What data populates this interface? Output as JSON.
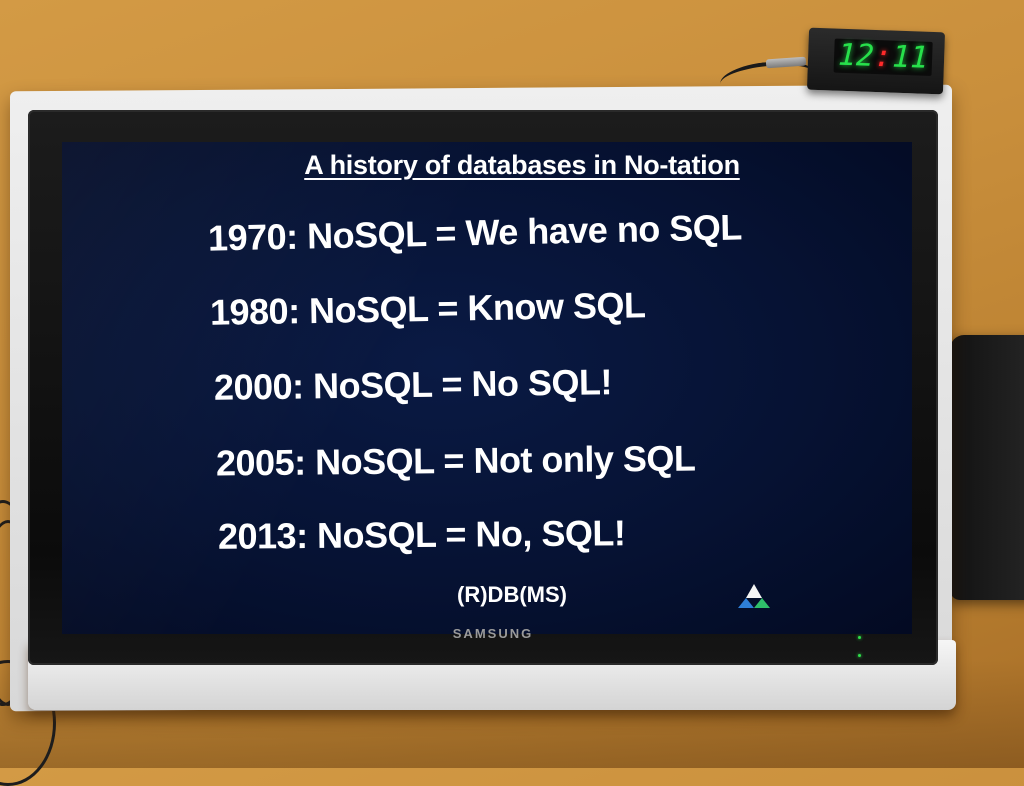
{
  "slide": {
    "title": "A history of databases in No-tation",
    "lines": [
      "1970: NoSQL = We have no SQL",
      "1980: NoSQL = Know SQL",
      "2000: NoSQL = No SQL!",
      "2005: NoSQL = Not only SQL",
      "2013: NoSQL = No, SQL!"
    ],
    "footer": "(R)DB(MS)"
  },
  "monitor": {
    "brand": "SAMSUNG"
  },
  "clock": {
    "hours": "12",
    "minutes": "11"
  },
  "colors": {
    "slide_background": "#061233",
    "slide_text": "#ffffff",
    "clock_digits": "#27e04b",
    "clock_colon": "#ff2a2a",
    "desk": "#c98f3c"
  }
}
